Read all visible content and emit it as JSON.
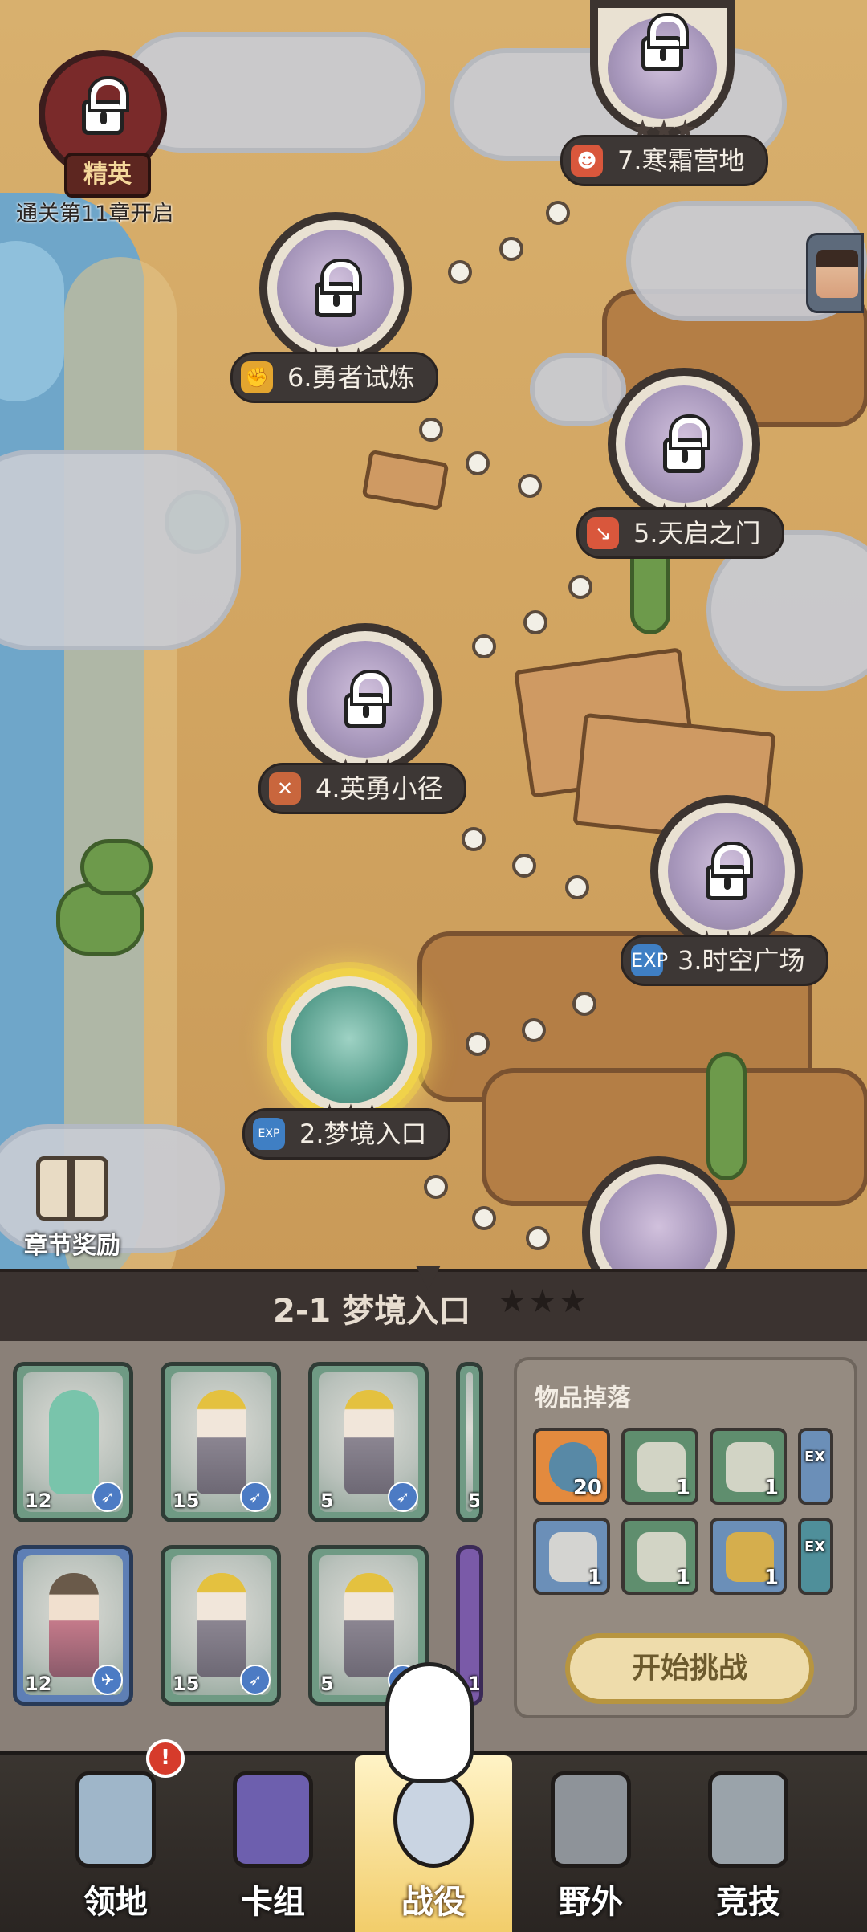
{
  "map": {
    "elite": {
      "label": "精英",
      "condition": "通关第11章开启"
    },
    "chapter_reward": "章节奖励",
    "stages": [
      {
        "id": 2,
        "label": "2.梦境入口",
        "stars": "★★★",
        "icon": "exp-icon",
        "state": "active"
      },
      {
        "id": 3,
        "label": "3.时空广场",
        "stars": "★★★",
        "icon": "exp-icon",
        "state": "locked"
      },
      {
        "id": 4,
        "label": "4.英勇小径",
        "stars": "★★★",
        "icon": "crossed-swords-icon",
        "state": "locked"
      },
      {
        "id": 5,
        "label": "5.天启之门",
        "stars": "★★★",
        "icon": "sword-icon",
        "state": "locked"
      },
      {
        "id": 6,
        "label": "6.勇者试炼",
        "stars": "★★★",
        "icon": "fist-icon",
        "state": "locked"
      },
      {
        "id": 7,
        "label": "7.寒霜营地",
        "stars": "★★★",
        "icon": "face-icon",
        "state": "locked"
      }
    ]
  },
  "banner": {
    "title": "2-1 梦境入口",
    "stars": "★★★"
  },
  "team": {
    "cards": [
      {
        "level": "12",
        "type": "slime"
      },
      {
        "level": "15",
        "type": "samurai"
      },
      {
        "level": "5",
        "type": "samurai"
      },
      {
        "level": "5",
        "type": "samurai"
      },
      {
        "level": "12",
        "type": "archer"
      },
      {
        "level": "15",
        "type": "samurai"
      },
      {
        "level": "5",
        "type": "samurai"
      },
      {
        "level": "1",
        "type": "mage"
      }
    ]
  },
  "drops": {
    "title": "物品掉落",
    "items": [
      {
        "qty": "20",
        "icon": "fish-icon"
      },
      {
        "qty": "1",
        "icon": "samurai-card-icon"
      },
      {
        "qty": "1",
        "icon": "monster-card-icon"
      },
      {
        "qty": "",
        "icon": "exp-icon"
      },
      {
        "qty": "1",
        "icon": "mystery-card-icon"
      },
      {
        "qty": "1",
        "icon": "monster-card-icon"
      },
      {
        "qty": "1",
        "icon": "puzzle-piece-icon"
      },
      {
        "qty": "",
        "icon": "exp-icon"
      }
    ]
  },
  "start_button": "开始挑战",
  "nav": {
    "items": [
      {
        "label": "领地",
        "badge": "!"
      },
      {
        "label": "卡组"
      },
      {
        "label": "战役",
        "active": true
      },
      {
        "label": "野外"
      },
      {
        "label": "竞技"
      }
    ]
  },
  "colors": {
    "accent": "#f0d24a",
    "panel": "#8a8078",
    "label_bg": "#3d3735"
  }
}
